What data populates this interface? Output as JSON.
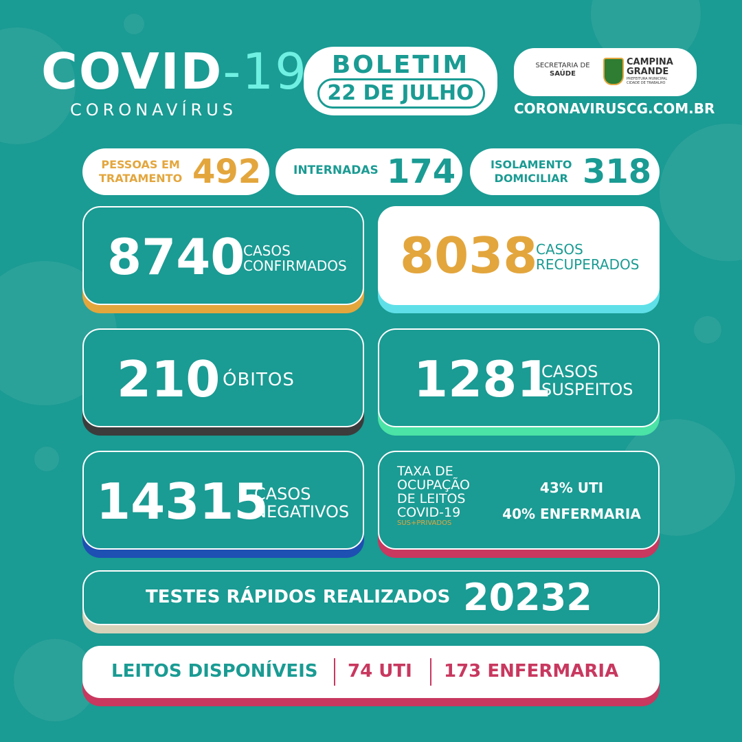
{
  "header": {
    "logo_covid": "COVID",
    "logo_dash19": "-19",
    "logo_sub": "CORONAVÍRUS",
    "boletim_label": "BOLETIM",
    "date": "22 DE JULHO",
    "secretaria_line1": "SECRETARIA DE",
    "secretaria_line2": "SAÚDE",
    "city_line1": "CAMPINA",
    "city_line2": "GRANDE",
    "city_tag1": "PREFEITURA MUNICIPAL",
    "city_tag2": "CIDADE DE TRABALHO",
    "website": "CORONAVIRUSCG.COM.BR"
  },
  "stats_top": [
    {
      "label1": "PESSOAS EM",
      "label2": "TRATAMENTO",
      "value": "492"
    },
    {
      "label1": "INTERNADAS",
      "label2": "",
      "value": "174"
    },
    {
      "label1": "ISOLAMENTO",
      "label2": "DOMICILIAR",
      "value": "318"
    }
  ],
  "cards": {
    "confirmados": {
      "value": "8740",
      "label1": "CASOS",
      "label2": "CONFIRMADOS"
    },
    "recuperados": {
      "value": "8038",
      "label1": "CASOS",
      "label2": "RECUPERADOS"
    },
    "obitos": {
      "value": "210",
      "label1": "ÓBITOS"
    },
    "suspeitos": {
      "value": "1281",
      "label1": "CASOS",
      "label2": "SUSPEITOS"
    },
    "negativos": {
      "value": "14315",
      "label1": "CASOS",
      "label2": "NEGATIVOS"
    },
    "ocupacao": {
      "line1": "TAXA DE",
      "line2": "OCUPAÇÃO",
      "line3": "DE LEITOS",
      "line4": "COVID-19",
      "note": "SUS+PRIVADOS",
      "uti": "43% UTI",
      "enfermaria": "40% ENFERMARIA"
    }
  },
  "testes": {
    "label": "TESTES RÁPIDOS REALIZADOS",
    "value": "20232"
  },
  "leitos": {
    "label": "LEITOS DISPONÍVEIS",
    "uti": "74 UTI",
    "enfermaria": "173 ENFERMARIA"
  },
  "colors": {
    "teal": "#1a9b93",
    "yellow": "#e3a63d",
    "cyan": "#5fe0e8",
    "dark": "#3c3c3c",
    "green": "#4be3a6",
    "blue": "#1e4fb2",
    "crimson": "#c8385f",
    "beige": "#d6d2ba"
  }
}
